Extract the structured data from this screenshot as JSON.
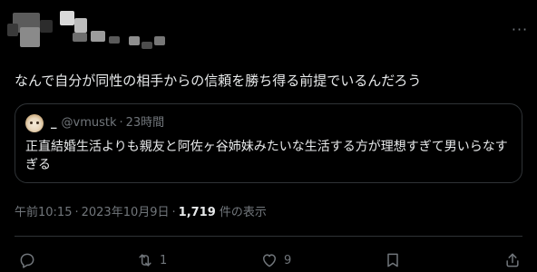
{
  "author": {
    "display_name_redacted": true,
    "handle_redacted": true
  },
  "more_icon": "more-horizontal-icon",
  "tweet": {
    "text": "なんで自分が同性の相手からの信頼を勝ち得る前提でいるんだろう"
  },
  "quote": {
    "name": "_",
    "handle": "@vmustk",
    "dot": "·",
    "time": "23時間",
    "text": "正直結婚生活よりも親友と阿佐ヶ谷姉妹みたいな生活する方が理想すぎて男いらなすぎる"
  },
  "meta": {
    "time": "午前10:15",
    "dot": "·",
    "date": "2023年10月9日",
    "dot2": "·",
    "views_count": "1,719",
    "views_label": "件の表示"
  },
  "actions": {
    "reply": {
      "icon": "reply-icon",
      "count": ""
    },
    "retweet": {
      "icon": "retweet-icon",
      "count": "1"
    },
    "like": {
      "icon": "heart-icon",
      "count": "9"
    },
    "bookmark": {
      "icon": "bookmark-icon",
      "count": ""
    },
    "share": {
      "icon": "share-icon",
      "count": ""
    }
  },
  "colors": {
    "background": "#000000",
    "text_primary": "#e7e9ea",
    "text_secondary": "#71767b",
    "border": "#2f3336"
  }
}
